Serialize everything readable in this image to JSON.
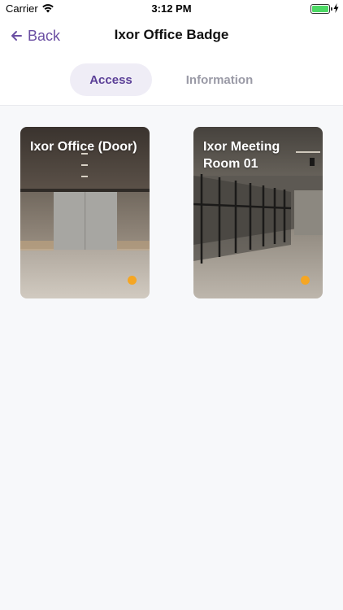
{
  "status_bar": {
    "carrier": "Carrier",
    "time": "3:12 PM",
    "battery_level": 1.0
  },
  "nav": {
    "back_label": "Back",
    "title": "Ixor Office Badge",
    "accent_color": "#6b4fa3"
  },
  "tabs": [
    {
      "label": "Access",
      "selected": true
    },
    {
      "label": "Information",
      "selected": false
    }
  ],
  "doors": [
    {
      "name": "Ixor Office (Door)",
      "status_color": "#f5a623",
      "image": "office-lobby-door-photo"
    },
    {
      "name": "Ixor Meeting Room 01",
      "status_color": "#f5a623",
      "image": "glass-meeting-room-photo"
    }
  ]
}
